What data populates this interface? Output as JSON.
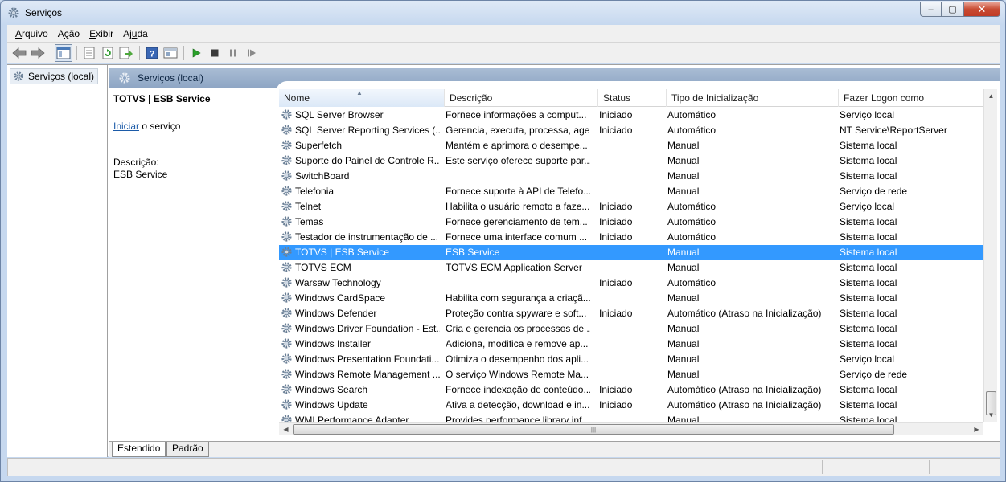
{
  "window": {
    "title": "Serviços",
    "controls": {
      "minimize": "‒",
      "maximize": "▢",
      "close": "✕"
    }
  },
  "menu": [
    {
      "pre": "",
      "accel": "A",
      "post": "rquivo"
    },
    {
      "pre": "A",
      "accel": "ç",
      "post": "ão"
    },
    {
      "pre": "",
      "accel": "E",
      "post": "xibir"
    },
    {
      "pre": "Aj",
      "accel": "u",
      "post": "da"
    }
  ],
  "toolbar_icons": [
    "back-arrow-icon",
    "forward-arrow-icon",
    "show-hide-console-tree-icon",
    "properties-icon",
    "refresh-icon",
    "export-list-icon",
    "help-icon",
    "console-view-icon",
    "start-service-icon",
    "stop-service-icon",
    "pause-service-icon",
    "restart-service-icon"
  ],
  "tree": {
    "root": "Serviços (local)"
  },
  "pane": {
    "header": "Serviços (local)"
  },
  "detail": {
    "service_name": "TOTVS | ESB Service",
    "start_link": "Iniciar",
    "start_suffix": " o serviço",
    "description_label": "Descrição:",
    "description_text": "ESB Service"
  },
  "columns": [
    "Nome",
    "Descrição",
    "Status",
    "Tipo de Inicialização",
    "Fazer Logon como"
  ],
  "rows": [
    {
      "name": "SQL Server Browser",
      "desc": "Fornece informações a comput...",
      "status": "Iniciado",
      "start": "Automático",
      "logon": "Serviço local"
    },
    {
      "name": "SQL Server Reporting Services (...",
      "desc": "Gerencia, executa, processa, age...",
      "status": "Iniciado",
      "start": "Automático",
      "logon": "NT Service\\ReportServer"
    },
    {
      "name": "Superfetch",
      "desc": "Mantém e aprimora o desempe...",
      "status": "",
      "start": "Manual",
      "logon": "Sistema local"
    },
    {
      "name": "Suporte do Painel de Controle R...",
      "desc": "Este serviço oferece suporte par...",
      "status": "",
      "start": "Manual",
      "logon": "Sistema local"
    },
    {
      "name": "SwitchBoard",
      "desc": "",
      "status": "",
      "start": "Manual",
      "logon": "Sistema local"
    },
    {
      "name": "Telefonia",
      "desc": "Fornece suporte à API de Telefo...",
      "status": "",
      "start": "Manual",
      "logon": "Serviço de rede"
    },
    {
      "name": "Telnet",
      "desc": "Habilita o usuário remoto a faze...",
      "status": "Iniciado",
      "start": "Automático",
      "logon": "Serviço local"
    },
    {
      "name": "Temas",
      "desc": "Fornece gerenciamento de tem...",
      "status": "Iniciado",
      "start": "Automático",
      "logon": "Sistema local"
    },
    {
      "name": "Testador de instrumentação de ...",
      "desc": "Fornece uma interface comum ...",
      "status": "Iniciado",
      "start": "Automático",
      "logon": "Sistema local"
    },
    {
      "name": "TOTVS | ESB Service",
      "desc": "ESB Service",
      "status": "",
      "start": "Manual",
      "logon": "Sistema local",
      "selected": true
    },
    {
      "name": "TOTVS ECM",
      "desc": "TOTVS ECM Application Server",
      "status": "",
      "start": "Manual",
      "logon": "Sistema local"
    },
    {
      "name": "Warsaw Technology",
      "desc": "",
      "status": "Iniciado",
      "start": "Automático",
      "logon": "Sistema local"
    },
    {
      "name": "Windows CardSpace",
      "desc": "Habilita com segurança a criaçã...",
      "status": "",
      "start": "Manual",
      "logon": "Sistema local"
    },
    {
      "name": "Windows Defender",
      "desc": "Proteção contra spyware e soft...",
      "status": "Iniciado",
      "start": "Automático (Atraso na Inicialização)",
      "logon": "Sistema local"
    },
    {
      "name": "Windows Driver Foundation - Est...",
      "desc": "Cria e gerencia os processos de ...",
      "status": "",
      "start": "Manual",
      "logon": "Sistema local"
    },
    {
      "name": "Windows Installer",
      "desc": "Adiciona, modifica e remove ap...",
      "status": "",
      "start": "Manual",
      "logon": "Sistema local"
    },
    {
      "name": "Windows Presentation Foundati...",
      "desc": "Otimiza o desempenho dos apli...",
      "status": "",
      "start": "Manual",
      "logon": "Serviço local"
    },
    {
      "name": "Windows Remote Management ...",
      "desc": "O serviço Windows Remote Ma...",
      "status": "",
      "start": "Manual",
      "logon": "Serviço de rede"
    },
    {
      "name": "Windows Search",
      "desc": "Fornece indexação de conteúdo...",
      "status": "Iniciado",
      "start": "Automático (Atraso na Inicialização)",
      "logon": "Sistema local"
    },
    {
      "name": "Windows Update",
      "desc": "Ativa a detecção, download e in...",
      "status": "Iniciado",
      "start": "Automático (Atraso na Inicialização)",
      "logon": "Sistema local"
    },
    {
      "name": "WMI Performance Adapter",
      "desc": "Provides performance library inf...",
      "status": "",
      "start": "Manual",
      "logon": "Sistema local"
    }
  ],
  "tabs": [
    "Estendido",
    "Padrão"
  ],
  "colors": {
    "selection": "#3399ff",
    "link": "#1c5ba8",
    "pane_header": "#9fb4cf"
  }
}
